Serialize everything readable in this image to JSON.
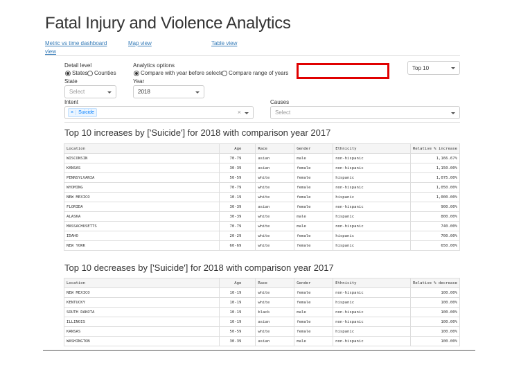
{
  "page": {
    "title": "Fatal Injury and Violence Analytics"
  },
  "nav": {
    "dashboard_line1": "Metric vs time dashboard",
    "dashboard_line2": "view",
    "map": "Map view",
    "table": "Table view"
  },
  "filters": {
    "detail_level_label": "Detail level",
    "detail_options": [
      "States",
      "Counties"
    ],
    "detail_selected": "States",
    "analytics_label": "Analytics options",
    "analytics_options": [
      "Compare with year before selected",
      "Compare range of years"
    ],
    "analytics_selected": "Compare with year before selected",
    "highlight_input_value": "",
    "topn_value": "Top 10",
    "state_label": "State",
    "state_placeholder": "Select",
    "year_label": "Year",
    "year_value": "2018",
    "intent_label": "Intent",
    "intent_tag": "Suicide",
    "intent_tag_remove": "×",
    "intent_clear": "×",
    "causes_label": "Causes",
    "causes_placeholder": "Select"
  },
  "increases": {
    "heading": "Top 10 increases by ['Suicide'] for 2018 with comparison year 2017",
    "columns": [
      "Location",
      "Age",
      "Race",
      "Gender",
      "Ethnicity",
      "Relative % increase"
    ],
    "rows": [
      [
        "WISCONSIN",
        "70-79",
        "asian",
        "male",
        "non-hispanic",
        "1,166.67%"
      ],
      [
        "KANSAS",
        "30-39",
        "asian",
        "female",
        "non-hispanic",
        "1,150.00%"
      ],
      [
        "PENNSYLVANIA",
        "50-59",
        "white",
        "female",
        "hispanic",
        "1,075.00%"
      ],
      [
        "WYOMING",
        "70-79",
        "white",
        "female",
        "non-hispanic",
        "1,050.00%"
      ],
      [
        "NEW MEXICO",
        "10-19",
        "white",
        "female",
        "hispanic",
        "1,000.00%"
      ],
      [
        "FLORIDA",
        "30-39",
        "asian",
        "female",
        "non-hispanic",
        "900.00%"
      ],
      [
        "ALASKA",
        "30-39",
        "white",
        "male",
        "hispanic",
        "800.00%"
      ],
      [
        "MASSACHUSETTS",
        "70-79",
        "white",
        "male",
        "non-hispanic",
        "740.00%"
      ],
      [
        "IDAHO",
        "20-29",
        "white",
        "female",
        "hispanic",
        "700.00%"
      ],
      [
        "NEW YORK",
        "60-69",
        "white",
        "female",
        "hispanic",
        "650.00%"
      ]
    ]
  },
  "decreases": {
    "heading": "Top 10 decreases by ['Suicide'] for 2018 with comparison year 2017",
    "columns": [
      "Location",
      "Age",
      "Race",
      "Gender",
      "Ethnicity",
      "Relative % decrease"
    ],
    "rows": [
      [
        "NEW MEXICO",
        "10-19",
        "white",
        "female",
        "non-hispanic",
        "100.00%"
      ],
      [
        "KENTUCKY",
        "10-19",
        "white",
        "female",
        "hispanic",
        "100.00%"
      ],
      [
        "SOUTH DAKOTA",
        "10-19",
        "black",
        "male",
        "non-hispanic",
        "100.00%"
      ],
      [
        "ILLINOIS",
        "10-19",
        "asian",
        "female",
        "non-hispanic",
        "100.00%"
      ],
      [
        "KANSAS",
        "50-59",
        "white",
        "female",
        "hispanic",
        "100.00%"
      ],
      [
        "WASHINGTON",
        "30-39",
        "asian",
        "male",
        "non-hispanic",
        "100.00%"
      ]
    ]
  }
}
